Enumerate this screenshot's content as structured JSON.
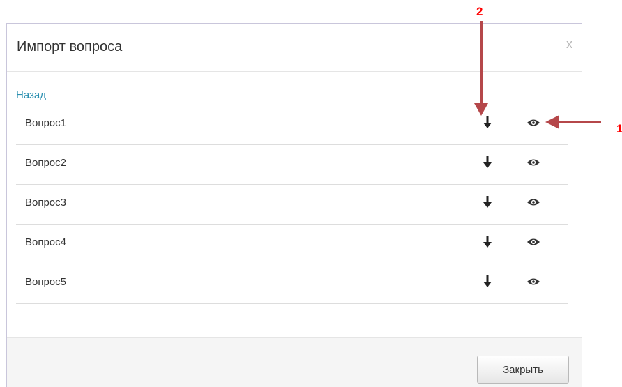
{
  "modal": {
    "title": "Импорт вопроса",
    "close_glyph": "x",
    "back_label": "Назад",
    "close_button_label": "Закрыть"
  },
  "questions": [
    {
      "label": "Вопрос1",
      "import_icon": "arrow-down-icon",
      "view_icon": "eye-icon"
    },
    {
      "label": "Вопрос2",
      "import_icon": "arrow-down-icon",
      "view_icon": "eye-icon"
    },
    {
      "label": "Вопрос3",
      "import_icon": "arrow-down-icon",
      "view_icon": "eye-icon"
    },
    {
      "label": "Вопрос4",
      "import_icon": "arrow-down-icon",
      "view_icon": "eye-icon"
    },
    {
      "label": "Вопрос5",
      "import_icon": "arrow-down-icon",
      "view_icon": "eye-icon"
    }
  ],
  "annotations": {
    "marker_1": "1",
    "marker_2": "2",
    "color": "#b5474a",
    "number_color": "#ff0000"
  },
  "colors": {
    "link": "#2a8fb0",
    "modal_border": "#c9c6db",
    "footer_bg": "#f5f5f5"
  }
}
